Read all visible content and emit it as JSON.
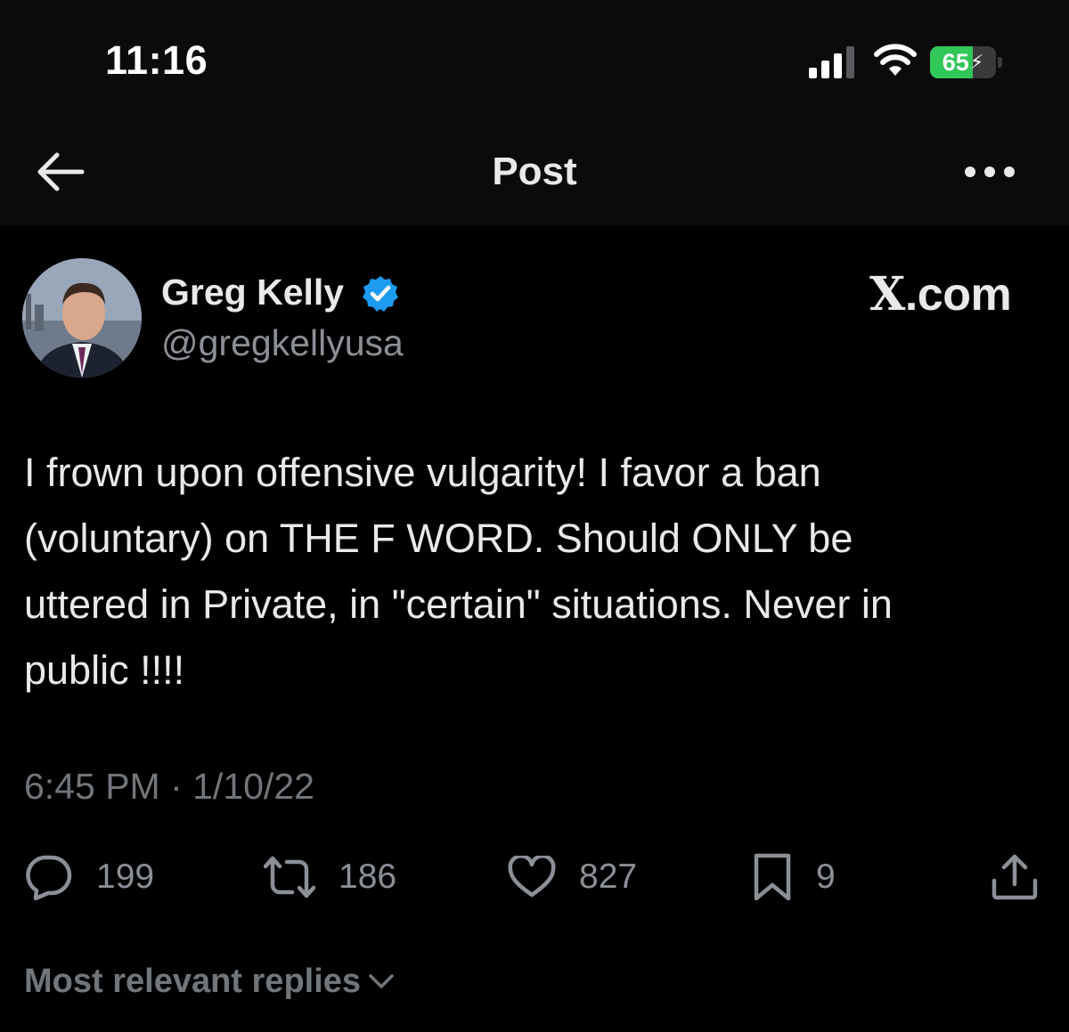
{
  "status_bar": {
    "time": "11:16",
    "battery_percent": "65",
    "battery_level": 0.65,
    "battery_color": "#31c759"
  },
  "nav": {
    "back_icon": "arrow-left-icon",
    "title": "Post",
    "more_icon": "more-horizontal-icon"
  },
  "post": {
    "author": {
      "name": "Greg Kelly",
      "handle": "@gregkellyusa",
      "verified": true,
      "verified_color": "#1d9bf0"
    },
    "brand": {
      "x": "X",
      "suffix": ".com"
    },
    "text": "I frown upon offensive vulgarity!  I favor a ban\n(voluntary) on THE F WORD. Should ONLY be\nuttered in Private, in \"certain\" situations. Never in\npublic !!!!",
    "timestamp": "6:45 PM · 1/10/22",
    "actions": {
      "replies": "199",
      "reposts": "186",
      "likes": "827",
      "bookmarks": "9"
    }
  },
  "replies_sort": {
    "label": "Most relevant replies"
  }
}
